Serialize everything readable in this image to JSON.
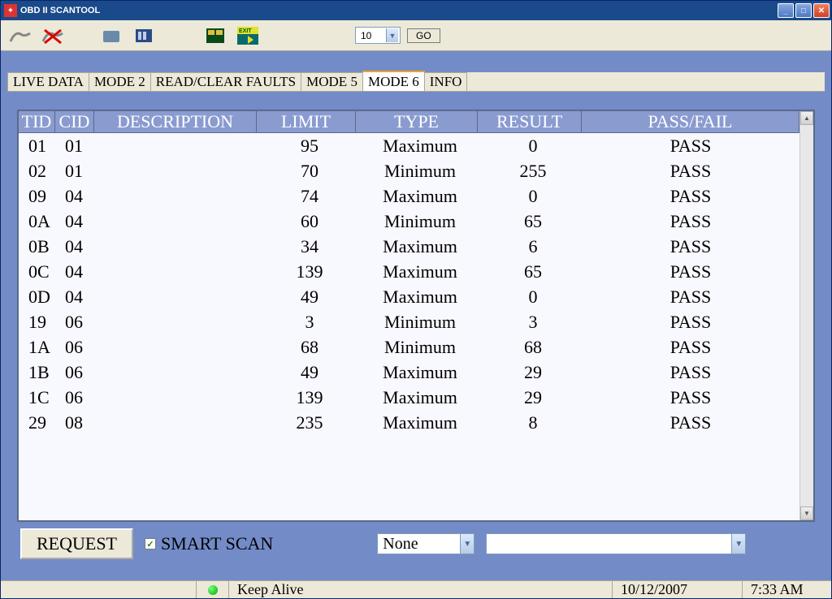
{
  "title": "OBD II SCANTOOL",
  "toolbar": {
    "combo_value": "10",
    "go_label": "GO"
  },
  "tabs": [
    "LIVE DATA",
    "MODE 2",
    "READ/CLEAR FAULTS",
    "MODE 5",
    "MODE 6",
    "INFO"
  ],
  "active_tab": 4,
  "columns": [
    "TID",
    "CID",
    "DESCRIPTION",
    "LIMIT",
    "TYPE",
    "RESULT",
    "PASS/FAIL"
  ],
  "rows": [
    {
      "tid": "01",
      "cid": "01",
      "desc": "",
      "limit": "95",
      "type": "Maximum",
      "result": "0",
      "pf": "PASS"
    },
    {
      "tid": "02",
      "cid": "01",
      "desc": "",
      "limit": "70",
      "type": "Minimum",
      "result": "255",
      "pf": "PASS"
    },
    {
      "tid": "09",
      "cid": "04",
      "desc": "",
      "limit": "74",
      "type": "Maximum",
      "result": "0",
      "pf": "PASS"
    },
    {
      "tid": "0A",
      "cid": "04",
      "desc": "",
      "limit": "60",
      "type": "Minimum",
      "result": "65",
      "pf": "PASS"
    },
    {
      "tid": "0B",
      "cid": "04",
      "desc": "",
      "limit": "34",
      "type": "Maximum",
      "result": "6",
      "pf": "PASS"
    },
    {
      "tid": "0C",
      "cid": "04",
      "desc": "",
      "limit": "139",
      "type": "Maximum",
      "result": "65",
      "pf": "PASS"
    },
    {
      "tid": "0D",
      "cid": "04",
      "desc": "",
      "limit": "49",
      "type": "Maximum",
      "result": "0",
      "pf": "PASS"
    },
    {
      "tid": "19",
      "cid": "06",
      "desc": "",
      "limit": "3",
      "type": "Minimum",
      "result": "3",
      "pf": "PASS"
    },
    {
      "tid": "1A",
      "cid": "06",
      "desc": "",
      "limit": "68",
      "type": "Minimum",
      "result": "68",
      "pf": "PASS"
    },
    {
      "tid": "1B",
      "cid": "06",
      "desc": "",
      "limit": "49",
      "type": "Maximum",
      "result": "29",
      "pf": "PASS"
    },
    {
      "tid": "1C",
      "cid": "06",
      "desc": "",
      "limit": "139",
      "type": "Maximum",
      "result": "29",
      "pf": "PASS"
    },
    {
      "tid": "29",
      "cid": "08",
      "desc": "",
      "limit": "235",
      "type": "Maximum",
      "result": "8",
      "pf": "PASS"
    }
  ],
  "controls": {
    "request_label": "REQUEST",
    "smart_scan_label": "SMART SCAN",
    "smart_scan_checked": true,
    "dropdown1_value": "None",
    "dropdown2_value": ""
  },
  "status": {
    "message": "Keep Alive",
    "date": "10/12/2007",
    "time": "7:33 AM"
  }
}
